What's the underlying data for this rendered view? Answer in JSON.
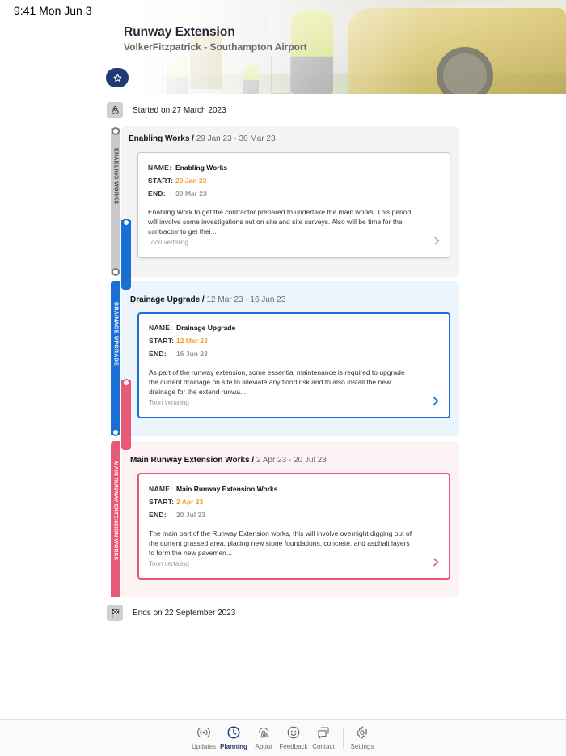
{
  "status_bar": {
    "time": "9:41 Mon Jun 3"
  },
  "header": {
    "title": "Runway Extension",
    "subtitle": "VolkerFitzpatrick - Southampton Airport"
  },
  "timeline": {
    "start_label": "Started on 27 March 2023",
    "end_label": "Ends on 22 September 2023",
    "phases": [
      {
        "rail_label": "ENABLING WORKS",
        "title": "Enabling Works / ",
        "dates": "29 Jan 23 - 30 Mar 23",
        "color": "#c9c9cc",
        "name_key": "NAME:",
        "name": "Enabling Works",
        "start_key": "START:",
        "start": "29 Jan 23",
        "end_key": "END:",
        "end": "30 Mar 23",
        "description": "Enabling Work to get the contractor prepared to undertake the main works. This period will involve some investigations out on site and site surveys. Also will be time for the contractor to get thei...",
        "translate": "Toon vertaling"
      },
      {
        "rail_label": "DRAINAGE UPGRADE",
        "title": "Drainage Upgrade / ",
        "dates": "12 Mar 23 - 16 Jun 23",
        "color": "#1a6fd6",
        "name_key": "NAME:",
        "name": "Drainage Upgrade",
        "start_key": "START:",
        "start": "12 Mar 23",
        "end_key": "END:",
        "end": "16 Jun 23",
        "description": "As part of the runway extension, some essential maintenance is required to upgrade the current drainage on site to alleviate any flood risk and to also install the new drainage for the extend runwa...",
        "translate": "Toon vertaling"
      },
      {
        "rail_label": "MAIN RUNWAY EXTENSION WORKS",
        "title": "Main Runway Extension Works / ",
        "dates": "2 Apr 23 - 20 Jul 23",
        "color": "#e65a78",
        "name_key": "NAME:",
        "name": "Main Runway Extension Works",
        "start_key": "START:",
        "start": "2 Apr 23",
        "end_key": "END:",
        "end": "20 Jul 23",
        "description": "The main part of the Runway Extension works, this will involve overnight digging out of the current grassed area, placing new stone foundations, concrete, and asphalt layers to form the new pavemen...",
        "translate": "Toon vertaling"
      }
    ]
  },
  "tabbar": {
    "items": [
      {
        "label": "Updates",
        "icon": "broadcast-icon"
      },
      {
        "label": "Planning",
        "icon": "clock-icon",
        "active": true
      },
      {
        "label": "About",
        "icon": "fingerprint-icon"
      },
      {
        "label": "Feedback",
        "icon": "smiley-icon"
      },
      {
        "label": "Contact",
        "icon": "chat-bubbles-icon"
      },
      {
        "label": "Settings",
        "icon": "gear-icon"
      }
    ]
  },
  "colors": {
    "accent": "#1f3b73",
    "start_date": "#f0a030",
    "end_date": "#9a9a9a",
    "enabling": "#c9c9cc",
    "drainage": "#1a6fd6",
    "runway": "#e65a78"
  }
}
